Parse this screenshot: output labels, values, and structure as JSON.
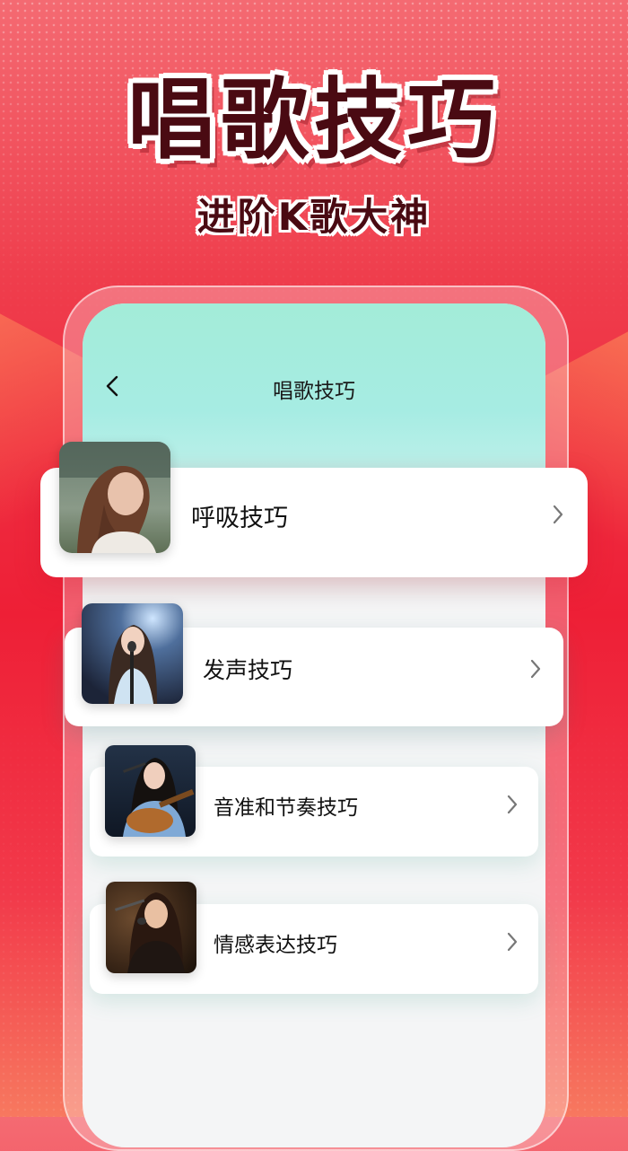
{
  "promo": {
    "title": "唱歌技巧",
    "subtitle": "进阶K歌大神"
  },
  "app": {
    "header_title": "唱歌技巧",
    "back_icon": "chevron-left-icon"
  },
  "skills": [
    {
      "label": "呼吸技巧",
      "image": "woman-eyes-closed-photo",
      "chevron_icon": "chevron-right-icon"
    },
    {
      "label": "发声技巧",
      "image": "woman-singing-microphone-stage-photo",
      "chevron_icon": "chevron-right-icon"
    },
    {
      "label": "音准和节奏技巧",
      "image": "woman-guitar-microphone-photo",
      "chevron_icon": "chevron-right-icon"
    },
    {
      "label": "情感表达技巧",
      "image": "woman-singing-band-photo",
      "chevron_icon": "chevron-right-icon"
    }
  ],
  "colors": {
    "background_red": "#ee1f36",
    "title_dark": "#4a0a12",
    "screen_mint": "#a3ecd8",
    "card_white": "#ffffff"
  }
}
